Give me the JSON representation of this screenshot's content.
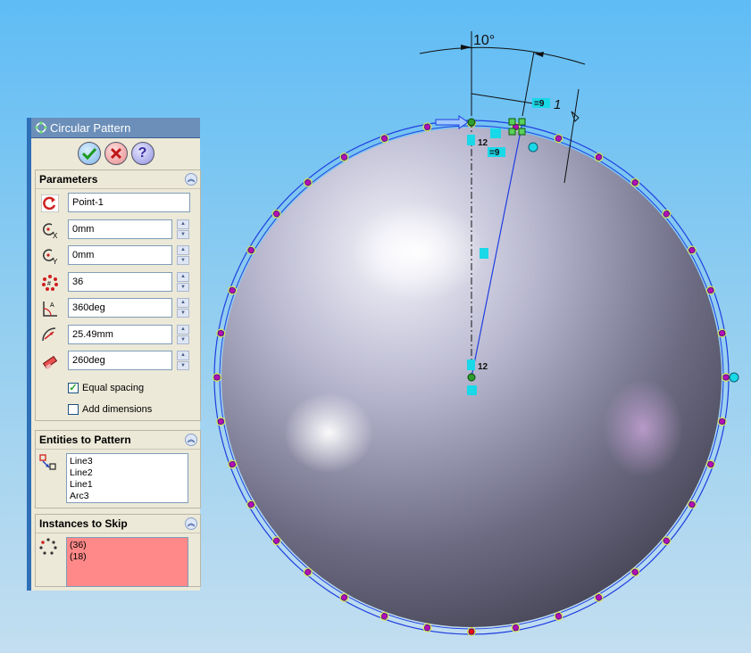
{
  "panel": {
    "title": "Circular Pattern",
    "sections": {
      "parameters": "Parameters",
      "entities": "Entities to Pattern",
      "skip": "Instances to Skip"
    },
    "params": {
      "center_point": "Point-1",
      "center_x": "0mm",
      "center_y": "0mm",
      "instances": "36",
      "total_angle": "360deg",
      "radius": "25.49mm",
      "angle": "260deg"
    },
    "equal_spacing": {
      "label": "Equal spacing",
      "checked": true
    },
    "add_dimensions": {
      "label": "Add dimensions",
      "checked": false
    },
    "entities": [
      "Line3",
      "Line2",
      "Line1",
      "Arc3"
    ],
    "skip_instances": [
      "(36)",
      "(18)"
    ]
  },
  "viewport": {
    "angle_dimension": "10°",
    "label_12_top": "12",
    "label_12_center": "12",
    "label_eq9_top": "=9",
    "label_eq9_mid": "=9",
    "label_dim_1": "1"
  },
  "colors": {
    "accent": "#2f6fb7",
    "sketch_blue": "#1f3ee0",
    "pattern_point": "#b40fb4",
    "skip_point": "#e01010",
    "relation_tag": "#19d8e8"
  }
}
